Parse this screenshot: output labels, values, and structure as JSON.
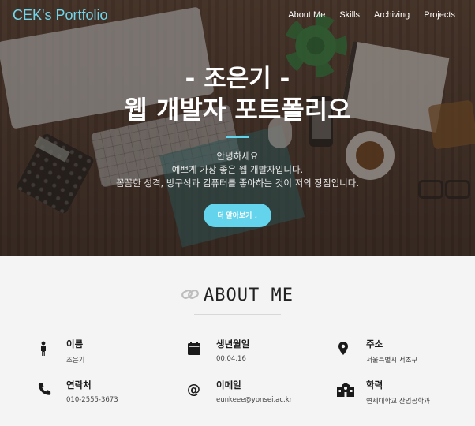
{
  "brand": "CEK's Portfolio",
  "nav": [
    "About Me",
    "Skills",
    "Archiving",
    "Projects"
  ],
  "hero": {
    "title_line1": "- 조은기 -",
    "title_line2": "웹 개발자 포트폴리오",
    "intro": [
      "안녕하세요",
      "예쁘게 가장 좋은 웹 개발자입니다.",
      "꼼꼼한 성격, 방구석과 컴퓨터를 좋아하는 것이 저의 장점입니다."
    ],
    "more_button": "더 알아보기 ↓"
  },
  "about": {
    "title": "ABOUT ME",
    "items": [
      {
        "icon": "person-icon",
        "label": "이름",
        "value": "조은기"
      },
      {
        "icon": "calendar-icon",
        "label": "생년월일",
        "value": "00.04.16"
      },
      {
        "icon": "location-pin-icon",
        "label": "주소",
        "value": "서울특별시 서초구"
      },
      {
        "icon": "phone-icon",
        "label": "연락처",
        "value": "010-2555-3673"
      },
      {
        "icon": "at-sign-icon",
        "label": "이메일",
        "value": "eunkeee@yonsei.ac.kr"
      },
      {
        "icon": "school-icon",
        "label": "학력",
        "value": "연세대학교 산업공학과"
      }
    ]
  },
  "colors": {
    "accent": "#63d4ec",
    "brand": "#6fd6ec",
    "text_dark": "#1a1a1a",
    "section_bg": "#f4f4f4"
  }
}
